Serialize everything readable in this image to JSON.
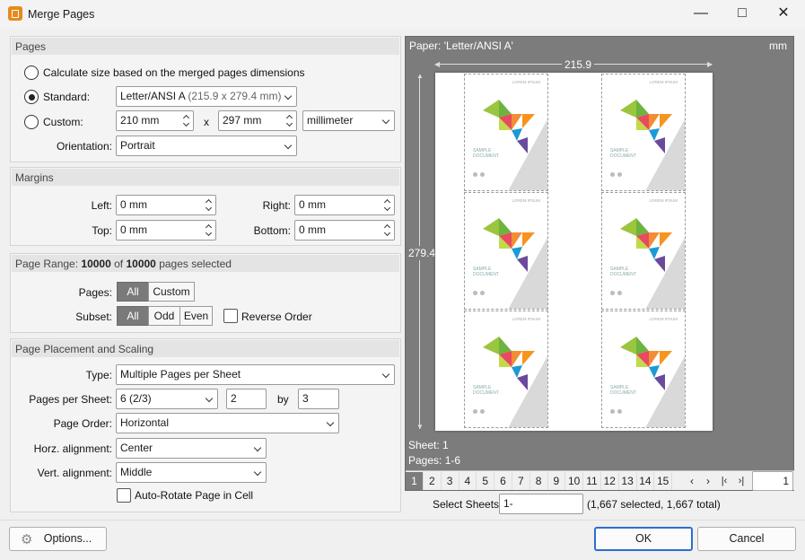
{
  "window": {
    "title": "Merge Pages",
    "controls": [
      "—",
      "□",
      "✕"
    ]
  },
  "pages_group": {
    "heading": "Pages",
    "calc_label": "Calculate size based on the merged pages dimensions",
    "standard_label": "Standard:",
    "standard_value": "Letter/ANSI A",
    "standard_dims": "(215.9 x 279.4 mm)",
    "custom_label": "Custom:",
    "custom_width": "210 mm",
    "custom_x": "x",
    "custom_height": "297 mm",
    "custom_unit": "millimeter",
    "orientation_label": "Orientation:",
    "orientation_value": "Portrait",
    "selected_mode": "standard"
  },
  "margins": {
    "heading": "Margins",
    "left_label": "Left:",
    "left_value": "0 mm",
    "right_label": "Right:",
    "right_value": "0 mm",
    "top_label": "Top:",
    "top_value": "0 mm",
    "bottom_label": "Bottom:",
    "bottom_value": "0 mm"
  },
  "page_range": {
    "heading_prefix": "Page Range:",
    "selected": "10000",
    "of": "of",
    "total": "10000",
    "suffix": "pages selected",
    "pages_label": "Pages:",
    "pages_options": [
      "All",
      "Custom"
    ],
    "pages_selected": "All",
    "subset_label": "Subset:",
    "subset_options": [
      "All",
      "Odd",
      "Even"
    ],
    "subset_selected": "All",
    "reverse_label": "Reverse Order",
    "reverse_checked": false
  },
  "placement": {
    "heading": "Page Placement and Scaling",
    "type_label": "Type:",
    "type_value": "Multiple Pages per Sheet",
    "pps_label": "Pages per Sheet:",
    "pps_value": "6 (2/3)",
    "pps_cols": "2",
    "by_label": "by",
    "pps_rows": "3",
    "order_label": "Page Order:",
    "order_value": "Horizontal",
    "horz_label": "Horz. alignment:",
    "horz_value": "Center",
    "vert_label": "Vert. alignment:",
    "vert_value": "Middle",
    "autorotate_label": "Auto-Rotate Page in Cell",
    "autorotate_checked": false
  },
  "preview": {
    "paper_label": "Paper: 'Letter/ANSI A'",
    "unit": "mm",
    "width_dim": "215.9",
    "height_dim": "279.4",
    "sheet_label": "Sheet: 1",
    "pages_label": "Pages: 1-6",
    "thumb_tag": "LOREM IPSUM",
    "thumb_title_1": "SAMPLE",
    "thumb_title_2": "DOCUMENT",
    "sheet_numbers": [
      "1",
      "2",
      "3",
      "4",
      "5",
      "6",
      "7",
      "8",
      "9",
      "10",
      "11",
      "12",
      "13",
      "14",
      "15"
    ],
    "current_sheet": "1",
    "nav": [
      "‹",
      "›",
      "|‹",
      "›|"
    ],
    "page_input": "1"
  },
  "select_sheets": {
    "label": "Select Sheets:",
    "value": "1-",
    "summary": "(1,667 selected, 1,667 total)"
  },
  "buttons": {
    "options": "Options...",
    "ok": "OK",
    "cancel": "Cancel"
  },
  "colors": {
    "accent": "#2a6fd1",
    "preview_bg": "#7c7c7c",
    "app_icon": "#e58a1c"
  }
}
